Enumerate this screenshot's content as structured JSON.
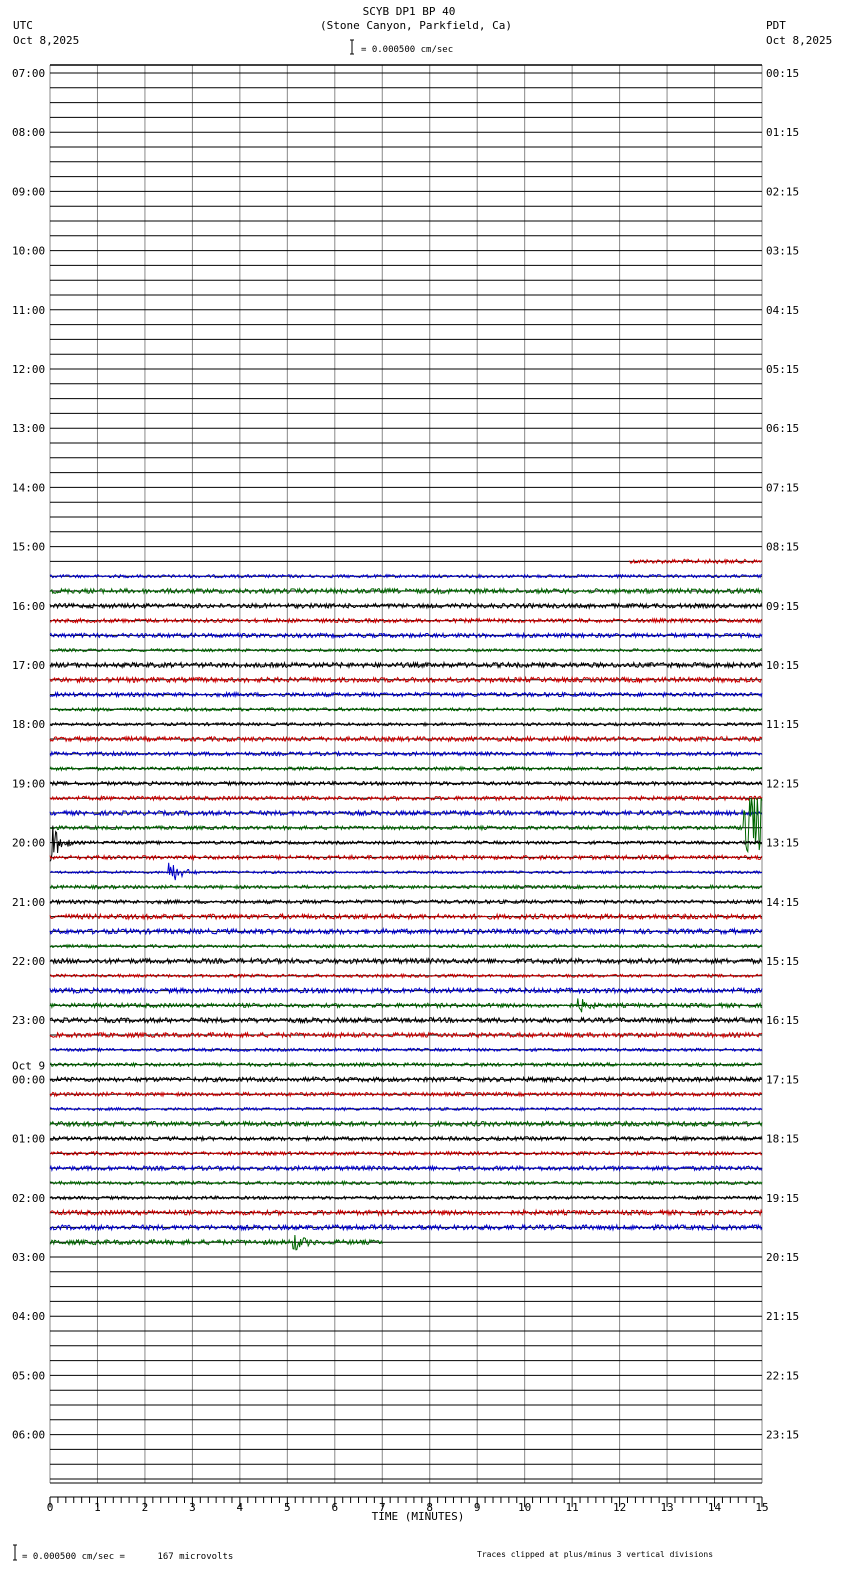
{
  "header": {
    "title": "SCYB DP1 BP 40",
    "subtitle": "(Stone Canyon, Parkfield, Ca)",
    "left_tz": "UTC",
    "left_date": "Oct 8,2025",
    "right_tz": "PDT",
    "right_date": "Oct 8,2025",
    "scale_text": "= 0.000500 cm/sec"
  },
  "footer": {
    "scale_text": "= 0.000500 cm/sec =      167 microvolts",
    "clip_note": "Traces clipped at plus/minus 3 vertical divisions"
  },
  "chart_data": {
    "type": "line",
    "title": "SCYB DP1 BP 40",
    "xlabel": "TIME (MINUTES)",
    "xlim": [
      0,
      15
    ],
    "x_ticks": [
      "0",
      "1",
      "2",
      "3",
      "4",
      "5",
      "6",
      "7",
      "8",
      "9",
      "10",
      "11",
      "12",
      "13",
      "14",
      "15"
    ],
    "rows_per_hour": 4,
    "left_labels": [
      "07:00",
      "08:00",
      "09:00",
      "10:00",
      "11:00",
      "12:00",
      "13:00",
      "14:00",
      "15:00",
      "16:00",
      "17:00",
      "18:00",
      "19:00",
      "20:00",
      "21:00",
      "22:00",
      "23:00",
      "00:00",
      "01:00",
      "02:00",
      "03:00",
      "04:00",
      "05:00",
      "06:00"
    ],
    "day_change_label": "Oct 9",
    "right_labels": [
      "00:15",
      "01:15",
      "02:15",
      "03:15",
      "04:15",
      "05:15",
      "06:15",
      "07:15",
      "08:15",
      "09:15",
      "10:15",
      "11:15",
      "12:15",
      "13:15",
      "14:15",
      "15:15",
      "16:15",
      "17:15",
      "18:15",
      "19:15",
      "20:15",
      "21:15",
      "22:15",
      "23:15"
    ],
    "trace_colors": [
      "#000000",
      "#cc0000",
      "#0000cc",
      "#006600"
    ],
    "data_start": {
      "row": 33,
      "minute": 12.2
    },
    "data_end": {
      "row": 79,
      "minute": 7.0
    },
    "events": [
      {
        "row": 51,
        "minute": 14.6,
        "duration": 0.4,
        "amp": 3,
        "label": "clipped"
      },
      {
        "row": 52,
        "minute": 0.0,
        "duration": 0.5,
        "amp": 1.6
      },
      {
        "row": 54,
        "minute": 2.5,
        "duration": 0.6,
        "amp": 0.9
      },
      {
        "row": 63,
        "minute": 11.1,
        "duration": 0.5,
        "amp": 0.6
      },
      {
        "row": 79,
        "minute": 5.1,
        "duration": 0.5,
        "amp": 0.7
      }
    ]
  }
}
